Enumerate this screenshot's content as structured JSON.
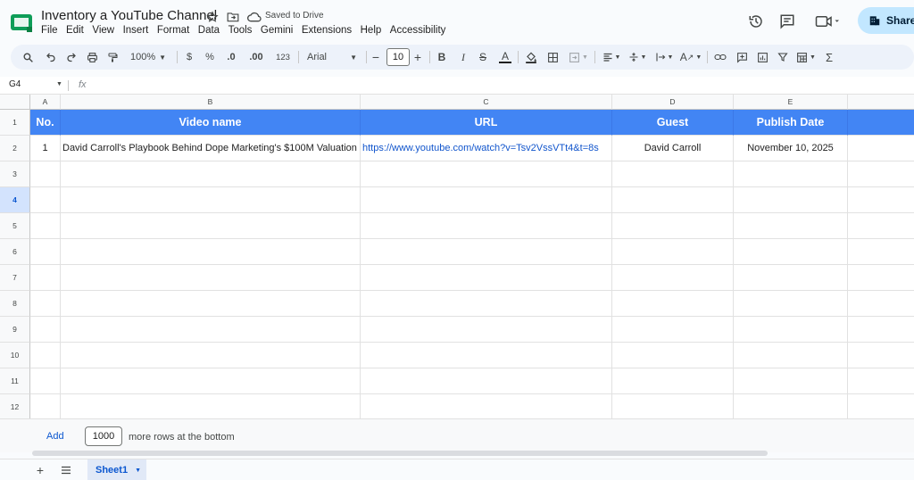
{
  "app": {
    "doc_title": "Inventory a YouTube Channel",
    "saved_status": "Saved to Drive",
    "share_label": "Share",
    "brand_color": "#0f9d58"
  },
  "menu": [
    "File",
    "Edit",
    "View",
    "Insert",
    "Format",
    "Data",
    "Tools",
    "Gemini",
    "Extensions",
    "Help",
    "Accessibility"
  ],
  "toolbar": {
    "zoom": "100%",
    "currency": "$",
    "percent": "%",
    "dec_decrease": ".0",
    "dec_increase": ".00",
    "more_formats": "123",
    "font": "Arial",
    "font_size": "10"
  },
  "formula_bar": {
    "name_box": "G4",
    "fx_label": "fx"
  },
  "columns": [
    "A",
    "B",
    "C",
    "D",
    "E"
  ],
  "rows": [
    "1",
    "2",
    "3",
    "4",
    "5",
    "6",
    "7",
    "8",
    "9",
    "10",
    "11",
    "12"
  ],
  "selected_row": "4",
  "table": {
    "header": [
      "No.",
      "Video name",
      "URL",
      "Guest",
      "Publish Date"
    ],
    "data": [
      [
        "1",
        "David Carroll's Playbook Behind Dope Marketing's $100M Valuation",
        "https://www.youtube.com/watch?v=Tsv2VssVTt4&t=8s",
        "David Carroll",
        "November 10, 2025"
      ]
    ],
    "header_color": "#4285f4"
  },
  "add_rows": {
    "button": "Add",
    "count": "1000",
    "suffix": "more rows at the bottom"
  },
  "sheets": [
    "Sheet1"
  ]
}
